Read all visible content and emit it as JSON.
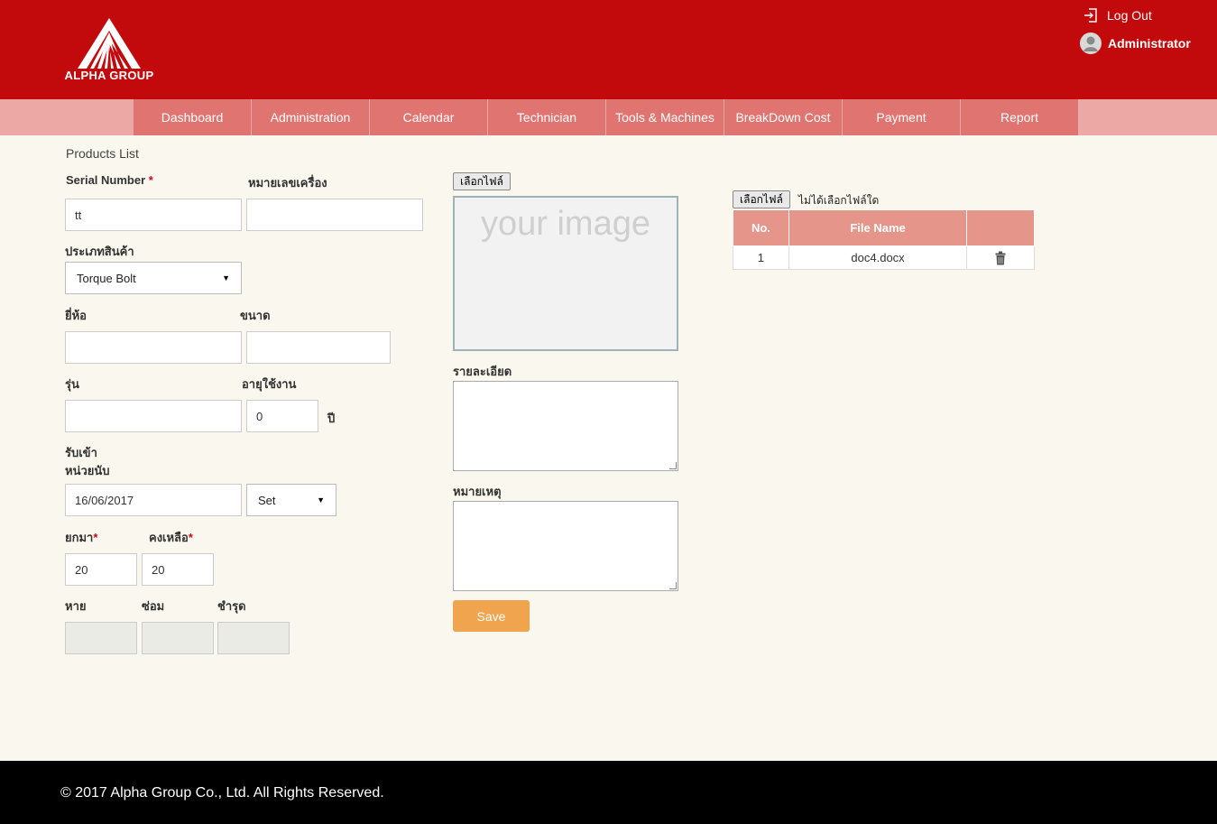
{
  "header": {
    "logo_text": "ALPHA GROUP",
    "logout_label": "Log Out",
    "user_name": "Administrator"
  },
  "nav": {
    "items": [
      {
        "label": "Dashboard"
      },
      {
        "label": "Administration"
      },
      {
        "label": "Calendar"
      },
      {
        "label": "Technician"
      },
      {
        "label": "Tools & Machines"
      },
      {
        "label": "BreakDown Cost"
      },
      {
        "label": "Payment"
      },
      {
        "label": "Report"
      }
    ]
  },
  "form": {
    "page_title": "Products List",
    "serial_number": {
      "label": "Serial Number",
      "required_mark": "*",
      "value": "tt"
    },
    "machine_number": {
      "label": "หมายเลขเครื่อง",
      "value": ""
    },
    "product_type": {
      "label": "ประเภทสินค้า",
      "selected": "Torque Bolt"
    },
    "brand": {
      "label": "ยี่ห้อ",
      "value": ""
    },
    "size": {
      "label": "ขนาด",
      "value": ""
    },
    "model": {
      "label": "รุ่น",
      "value": ""
    },
    "lifespan": {
      "label": "อายุใช้งาน",
      "value": "0",
      "unit": "ปี"
    },
    "received_label": "รับเข้า",
    "unit_label": "หน่วยนับ",
    "received_date": {
      "value": "16/06/2017"
    },
    "unit": {
      "selected": "Set"
    },
    "carried_forward": {
      "label": "ยกมา",
      "required_mark": "*",
      "value": "20"
    },
    "remaining": {
      "label": "คงเหลือ",
      "required_mark": "*",
      "value": "20"
    },
    "lost": {
      "label": "หาย",
      "value": ""
    },
    "repair": {
      "label": "ซ่อม",
      "value": ""
    },
    "damaged": {
      "label": "ชำรุด",
      "value": ""
    }
  },
  "image_panel": {
    "choose_file_label": "เลือกไฟล์",
    "placeholder": "your image",
    "details_label": "รายละเอียด",
    "notes_label": "หมายเหตุ",
    "save_label": "Save"
  },
  "files_panel": {
    "choose_file_label": "เลือกไฟล์",
    "no_file_text": "ไม่ได้เลือกไฟล์ใด",
    "columns": [
      "No.",
      "File Name",
      ""
    ],
    "rows": [
      {
        "no": "1",
        "file_name": "doc4.docx",
        "action_icon": "trash-icon"
      }
    ]
  },
  "footer": {
    "copyright": "© 2017 Alpha Group Co., Ltd. All Rights Reserved."
  },
  "colors": {
    "header_bg": "#c20a0c",
    "nav_bg": "#e07471",
    "nav_side_bg": "#eba8a4",
    "page_bg": "#faf8ee",
    "save_button": "#f0a44e",
    "table_header": "#e5958a",
    "footer_bg": "#000000"
  }
}
